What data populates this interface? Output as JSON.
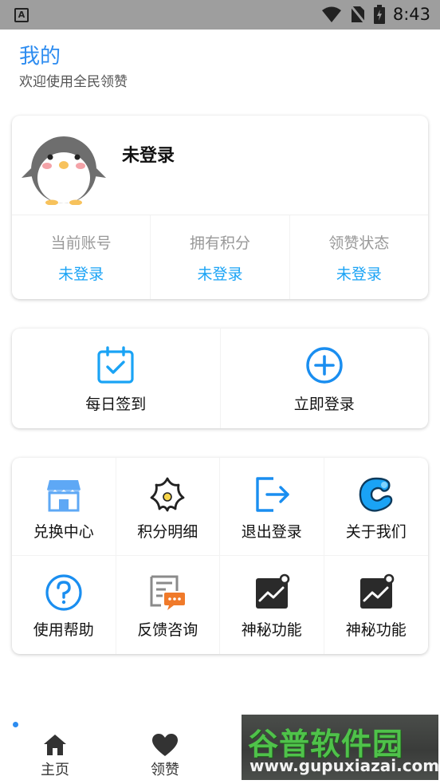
{
  "status_bar": {
    "time": "8:43",
    "app_badge": "A"
  },
  "header": {
    "title": "我的",
    "subtitle": "欢迎使用全民领赞"
  },
  "profile": {
    "name": "未登录",
    "stats": [
      {
        "label": "当前账号",
        "value": "未登录"
      },
      {
        "label": "拥有积分",
        "value": "未登录"
      },
      {
        "label": "领赞状态",
        "value": "未登录"
      }
    ]
  },
  "actions": [
    {
      "label": "每日签到",
      "icon": "calendar-check-icon"
    },
    {
      "label": "立即登录",
      "icon": "plus-circle-icon"
    }
  ],
  "grid": [
    {
      "label": "兑换中心",
      "icon": "store-icon"
    },
    {
      "label": "积分明细",
      "icon": "star-flower-icon"
    },
    {
      "label": "退出登录",
      "icon": "logout-icon"
    },
    {
      "label": "关于我们",
      "icon": "app-logo-icon"
    },
    {
      "label": "使用帮助",
      "icon": "help-circle-icon"
    },
    {
      "label": "反馈咨询",
      "icon": "feedback-icon"
    },
    {
      "label": "神秘功能",
      "icon": "chart-line-icon"
    },
    {
      "label": "神秘功能",
      "icon": "chart-line-icon"
    }
  ],
  "bottom_nav": [
    {
      "label": "主页",
      "icon": "home-icon"
    },
    {
      "label": "领赞",
      "icon": "heart-icon"
    }
  ],
  "watermark": {
    "title": "谷普软件园",
    "url": "www.gupuxiazai.com"
  },
  "colors": {
    "accent": "#2d8cf0",
    "value_blue": "#1aa3f5",
    "status_bar": "#9e9e9e"
  }
}
